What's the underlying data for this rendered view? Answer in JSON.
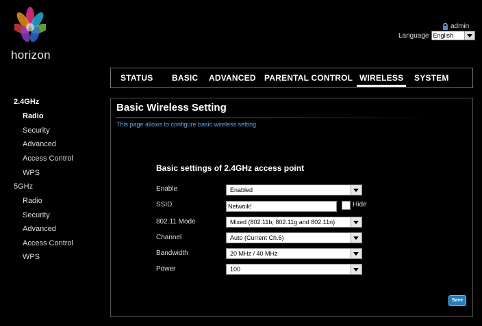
{
  "header": {
    "logo_text": "horizon",
    "user": "admin",
    "language_label": "Language",
    "language_value": "English"
  },
  "nav": {
    "tabs": [
      {
        "label": "STATUS"
      },
      {
        "label": "BASIC"
      },
      {
        "label": "ADVANCED"
      },
      {
        "label": "PARENTAL CONTROL"
      },
      {
        "label": "WIRELESS",
        "active": true
      },
      {
        "label": "SYSTEM"
      }
    ]
  },
  "sidebar": {
    "items": [
      {
        "label": "2.4GHz"
      },
      {
        "label": "Radio",
        "active": true
      },
      {
        "label": "Security"
      },
      {
        "label": "Advanced"
      },
      {
        "label": "Access Control"
      },
      {
        "label": "WPS"
      },
      {
        "label": "5GHz"
      },
      {
        "label": "Radio"
      },
      {
        "label": "Security"
      },
      {
        "label": "Advanced"
      },
      {
        "label": "Access Control"
      },
      {
        "label": "WPS"
      }
    ]
  },
  "main": {
    "title": "Basic Wireless Setting",
    "description": "This page allows to configure basic wireless setting",
    "form_title": "Basic settings of 2.4GHz access point",
    "fields": {
      "enable": {
        "label": "Enable",
        "value": "Enabled"
      },
      "ssid": {
        "label": "SSID",
        "value": "Netwoik!",
        "hide_label": "Hide",
        "hide_checked": false
      },
      "mode": {
        "label": "802.11 Mode",
        "value": "Mixed (802.11b, 802.11g and 802.11n)"
      },
      "channel": {
        "label": "Channel",
        "value": "Auto (Current Ch.6)"
      },
      "bandwidth": {
        "label": "Bandwidth",
        "value": "20 MHz / 40 MHz"
      },
      "power": {
        "label": "Power",
        "value": "100"
      }
    },
    "save_label": "Save"
  },
  "colors": {
    "background": "#000000",
    "accent_text": "#5ba6e2",
    "save_button": "#1f7fc0"
  }
}
